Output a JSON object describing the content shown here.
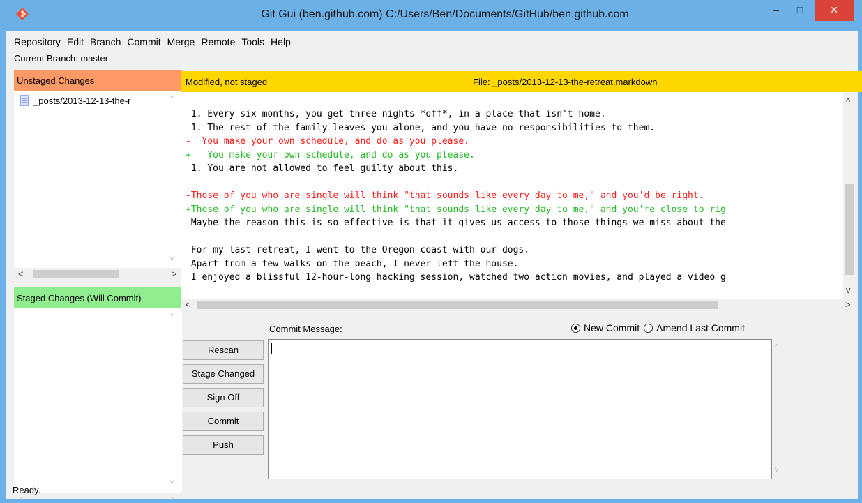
{
  "window": {
    "title": "Git Gui (ben.github.com) C:/Users/Ben/Documents/GitHub/ben.github.com",
    "min_glyph": "–",
    "max_glyph": "□",
    "close_glyph": "✕"
  },
  "menu": [
    "Repository",
    "Edit",
    "Branch",
    "Commit",
    "Merge",
    "Remote",
    "Tools",
    "Help"
  ],
  "branch_line": "Current Branch: master",
  "unstaged": {
    "header": "Unstaged Changes",
    "files": [
      "_posts/2013-12-13-the-r"
    ]
  },
  "staged": {
    "header": "Staged Changes (Will Commit)"
  },
  "diff": {
    "status": "Modified, not staged",
    "file_label": "File:  _posts/2013-12-13-the-retreat.markdown",
    "lines": [
      {
        "type": "ctx",
        "text": " 1. Every six months, you get three nights *off*, in a place that isn't home."
      },
      {
        "type": "ctx",
        "text": " 1. The rest of the family leaves you alone, and you have no responsibilities to them."
      },
      {
        "type": "del",
        "text": "-  You make your own schedule, and do as you please."
      },
      {
        "type": "add",
        "text": "+   You make your own schedule, and do as you please."
      },
      {
        "type": "ctx",
        "text": " 1. You are not allowed to feel guilty about this."
      },
      {
        "type": "ctx",
        "text": " "
      },
      {
        "type": "del",
        "text": "-Those of you who are single will think \"that sounds like every day to me,\" and you'd be right."
      },
      {
        "type": "add",
        "text": "+Those of you who are single will think \"that sounds like every day to me,\" and you're close to rig"
      },
      {
        "type": "ctx",
        "text": " Maybe the reason this is so effective is that it gives us access to those things we miss about the"
      },
      {
        "type": "ctx",
        "text": " "
      },
      {
        "type": "ctx",
        "text": " For my last retreat, I went to the Oregon coast with our dogs."
      },
      {
        "type": "ctx",
        "text": " Apart from a few walks on the beach, I never left the house."
      },
      {
        "type": "ctx",
        "text": " I enjoyed a blissful 12-hour-long hacking session, watched two action movies, and played a video g"
      }
    ]
  },
  "commit": {
    "label": "Commit Message:",
    "radio_new": "New Commit",
    "radio_amend": "Amend Last Commit",
    "new_selected": true,
    "message": ""
  },
  "buttons": {
    "rescan": "Rescan",
    "stage_changed": "Stage Changed",
    "sign_off": "Sign Off",
    "commit": "Commit",
    "push": "Push"
  },
  "status": "Ready.",
  "colors": {
    "unstaged_header": "#ff9966",
    "staged_header": "#90ee90",
    "diff_header": "#ffd700",
    "deleted_line": "#ff2020",
    "added_line": "#26b826",
    "titlebar": "#6cb0e8",
    "close_button": "#d9433a"
  }
}
